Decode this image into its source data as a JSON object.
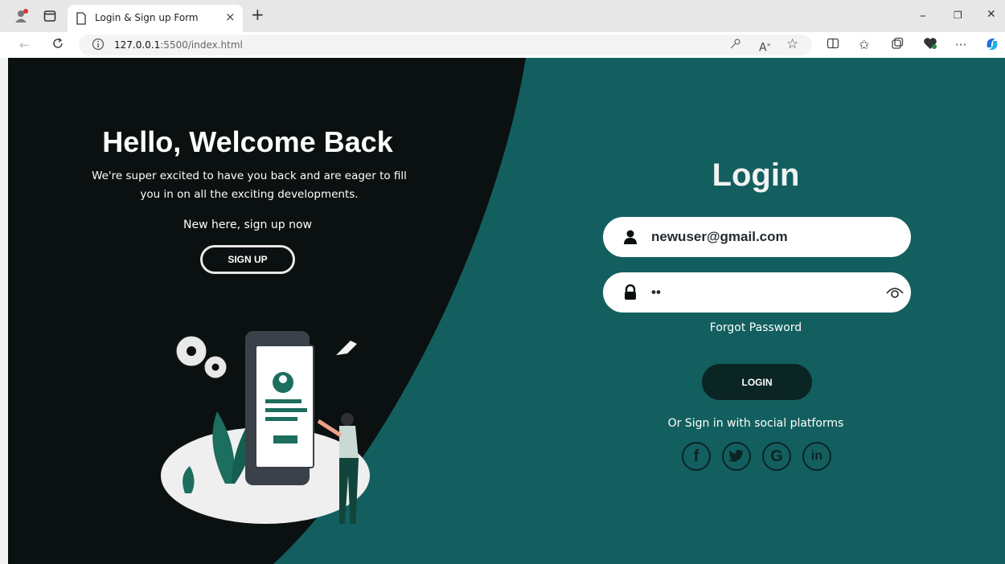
{
  "browser": {
    "tab_title": "Login & Sign up Form",
    "tab_close": "×",
    "new_tab": "+",
    "url_host": "127.0.0.1",
    "url_path": ":5500/index.html",
    "minimize": "–",
    "restore": "❐",
    "close": "✕",
    "more": "···"
  },
  "welcome": {
    "title": "Hello, Welcome Back",
    "text": "We're super excited to have you back and are eager to fill you in on all the exciting developments.",
    "new_here": "New here, sign up now",
    "signup_label": "SIGN UP"
  },
  "login": {
    "title": "Login",
    "email_value": "newuser@gmail.com",
    "password_value": "12",
    "forgot": "Forgot Password",
    "login_label": "LOGIN",
    "social_text": "Or Sign in with social platforms",
    "social": {
      "facebook": "f",
      "google": "G",
      "linkedin": "in"
    }
  },
  "colors": {
    "page_bg": "#135f5f",
    "dark_panel": "#0b1010",
    "button_dark": "#0b2424"
  }
}
